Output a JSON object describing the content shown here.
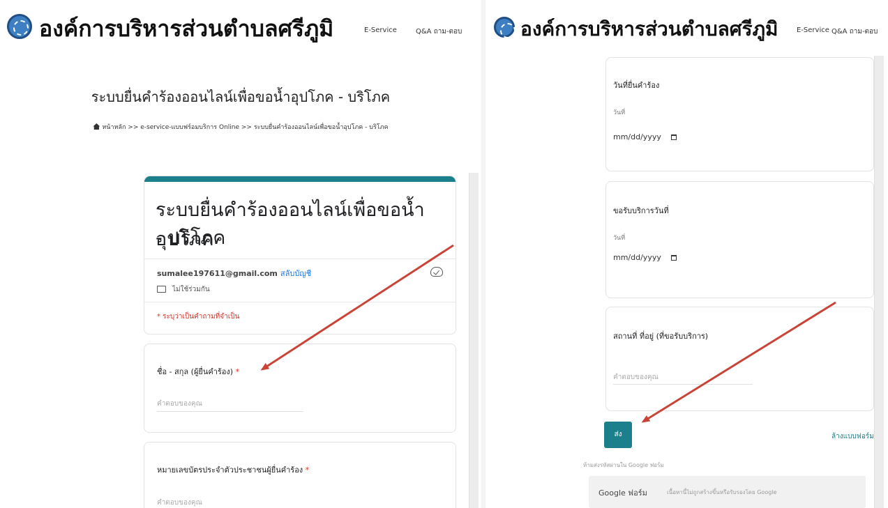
{
  "header": {
    "title": "องค์การบริหารส่วนตำบลศรีภูมิ",
    "nav": [
      "E-Service",
      "Q&A ถาม-ตอบ"
    ]
  },
  "left": {
    "page_title": "ระบบยื่นคำร้องออนไลน์เพื่อขอน้ำอุปโภค - บริโภค",
    "breadcrumb": "หน้าหลัก >> e-service-แบบฟร์อมบริการ Online >> ระบบยื่นคำร้องออนไลน์เพื่อขอน้ำอุปโภค - บริโภค",
    "form": {
      "title_line1": "ระบบยื่นคำร้องออนไลน์เพื่อขอน้ำอุปโภค",
      "title_line2": "- บริโภค",
      "email": "sumalee197611@gmail.com",
      "switch_account": "สลับบัญชี",
      "not_shared": "ไม่ใช้ร่วมกัน",
      "required_note": "* ระบุว่าเป็นคำถามที่จำเป็น",
      "questions": [
        {
          "label": "ชื่อ - สกุล (ผู้ยื่นคำร้อง)",
          "required_mark": "*",
          "placeholder": "คำตอบของคุณ"
        },
        {
          "label": "หมายเลขบัตรประจำตัวประชาชนผู้ยื่นคำร้อง",
          "required_mark": "*",
          "placeholder": "คำตอบของคุณ"
        }
      ]
    }
  },
  "right": {
    "questions": [
      {
        "label": "วันที่ยื่นคำร้อง",
        "sub_label": "วันที่",
        "date_value": "mm/dd/yyyy"
      },
      {
        "label": "ขอรับบริการวันที่",
        "sub_label": "วันที่",
        "date_value": "mm/dd/yyyy"
      },
      {
        "label": "สถานที่ ที่อยู่ (ที่ขอรับบริการ)",
        "placeholder": "คำตอบของคุณ"
      }
    ],
    "submit_label": "ส่ง",
    "clear_label": "ล้างแบบฟอร์ม",
    "footer_note": "ห้ามส่งรหัสผ่านใน Google ฟอร์ม",
    "google_brand": "Google ฟอร์ม",
    "google_note": "เนื้อหานี้ไม่ถูกสร้างขึ้นหรือรับรองโดย Google"
  },
  "colors": {
    "accent": "#1b7f8c",
    "required": "#d93025",
    "arrow": "#c94436",
    "link": "#1a73e8"
  },
  "icons": [
    "emblem-logo-icon",
    "home-icon",
    "cloud-check-icon",
    "no-save-icon",
    "calendar-icon",
    "arrow-annotation"
  ]
}
